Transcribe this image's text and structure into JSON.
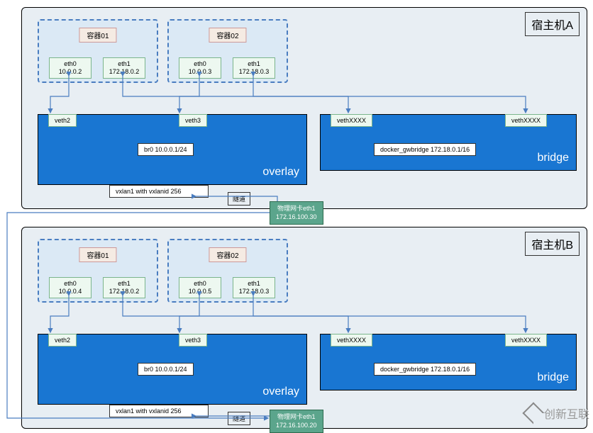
{
  "hosts": {
    "a": {
      "title": "宿主机A",
      "containers": [
        {
          "label": "容器01",
          "eth0": {
            "name": "eth0",
            "ip": "10.0.0.2"
          },
          "eth1": {
            "name": "eth1",
            "ip": "172.18.0.2"
          }
        },
        {
          "label": "容器02",
          "eth0": {
            "name": "eth0",
            "ip": "10.0.0.3"
          },
          "eth1": {
            "name": "eth1",
            "ip": "172.18.0.3"
          }
        }
      ],
      "overlay": {
        "veth1": "veth2",
        "veth2": "veth3",
        "br": "br0 10.0.0.1/24",
        "vxlan": "vxlan1 with vxlanid 256",
        "type": "overlay"
      },
      "bridge": {
        "veth1": "vethXXXX",
        "veth2": "vethXXXX",
        "gw": "docker_gwbridge 172.18.0.1/16",
        "type": "bridge"
      },
      "tunnel": "隧道",
      "physnic": {
        "name": "物理网卡eth1",
        "ip": "172.16.100.30"
      }
    },
    "b": {
      "title": "宿主机B",
      "containers": [
        {
          "label": "容器01",
          "eth0": {
            "name": "eth0",
            "ip": "10.0.0.4"
          },
          "eth1": {
            "name": "eth1",
            "ip": "172.18.0.2"
          }
        },
        {
          "label": "容器02",
          "eth0": {
            "name": "eth0",
            "ip": "10.0.0.5"
          },
          "eth1": {
            "name": "eth1",
            "ip": "172.18.0.3"
          }
        }
      ],
      "overlay": {
        "veth1": "veth2",
        "veth2": "veth3",
        "br": "br0 10.0.0.1/24",
        "vxlan": "vxlan1 with vxlanid 256",
        "type": "overlay"
      },
      "bridge": {
        "veth1": "vethXXXX",
        "veth2": "vethXXXX",
        "gw": "docker_gwbridge 172.18.0.1/16",
        "type": "bridge"
      },
      "tunnel": "隧道",
      "physnic": {
        "name": "物理网卡eth1",
        "ip": "172.16.100.20"
      }
    }
  },
  "watermark": "创新互联"
}
